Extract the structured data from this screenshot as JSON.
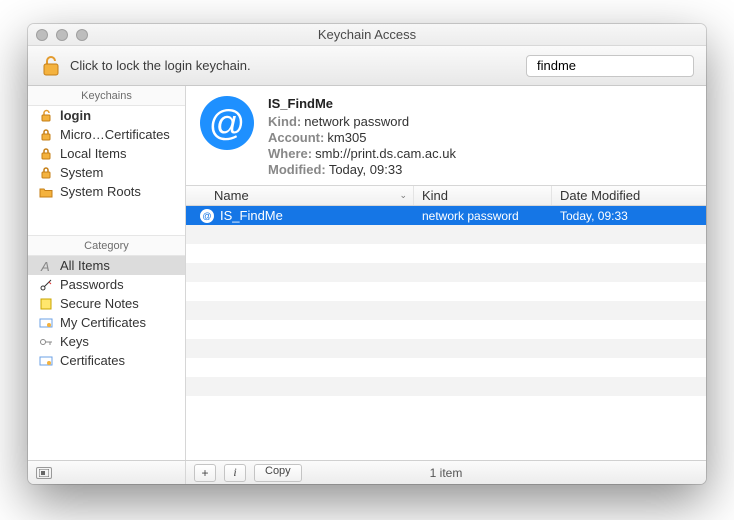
{
  "window": {
    "title": "Keychain Access"
  },
  "toolbar": {
    "lock_message": "Click to lock the login keychain.",
    "search": {
      "value": "findme",
      "placeholder": "Search"
    }
  },
  "sidebar": {
    "keychains_header": "Keychains",
    "keychains": [
      {
        "label": "login",
        "icon": "unlocked-padlock",
        "bold": true
      },
      {
        "label": "Micro…Certificates",
        "icon": "locked-padlock"
      },
      {
        "label": "Local Items",
        "icon": "locked-padlock"
      },
      {
        "label": "System",
        "icon": "locked-padlock"
      },
      {
        "label": "System Roots",
        "icon": "folder"
      }
    ],
    "category_header": "Category",
    "categories": [
      {
        "label": "All Items",
        "icon": "a-icon",
        "selected": true
      },
      {
        "label": "Passwords",
        "icon": "key-pen"
      },
      {
        "label": "Secure Notes",
        "icon": "note"
      },
      {
        "label": "My Certificates",
        "icon": "cert-badge"
      },
      {
        "label": "Keys",
        "icon": "key"
      },
      {
        "label": "Certificates",
        "icon": "cert"
      }
    ]
  },
  "detail": {
    "title": "IS_FindMe",
    "kind_label": "Kind:",
    "kind_value": "network password",
    "account_label": "Account:",
    "account_value": "km305",
    "where_label": "Where:",
    "where_value": "smb://print.ds.cam.ac.uk",
    "modified_label": "Modified:",
    "modified_value": "Today, 09:33"
  },
  "table": {
    "columns": {
      "name": "Name",
      "kind": "Kind",
      "date": "Date Modified"
    },
    "rows": [
      {
        "name": "IS_FindMe",
        "kind": "network password",
        "date": "Today, 09:33",
        "selected": true
      }
    ]
  },
  "footer": {
    "add_tooltip": "+",
    "info_tooltip": "i",
    "copy_label": "Copy",
    "count": "1 item"
  }
}
